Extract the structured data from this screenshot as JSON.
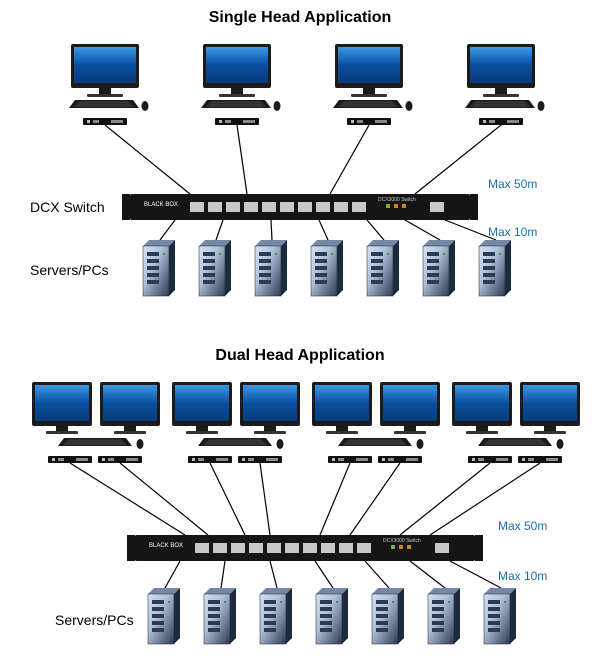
{
  "single": {
    "title": "Single Head Application",
    "switch_label": "DCX Switch",
    "servers_label": "Servers/PCs",
    "max_top": "Max 50m",
    "max_bottom": "Max 10m",
    "switch_text1": "BLACK BOX",
    "switch_text2": "DCX3000 Switch"
  },
  "dual": {
    "title": "Dual Head Application",
    "servers_label": "Servers/PCs",
    "max_top": "Max 50m",
    "max_bottom": "Max 10m",
    "switch_text1": "BLACK BOX",
    "switch_text2": "DCX3000 Switch"
  }
}
